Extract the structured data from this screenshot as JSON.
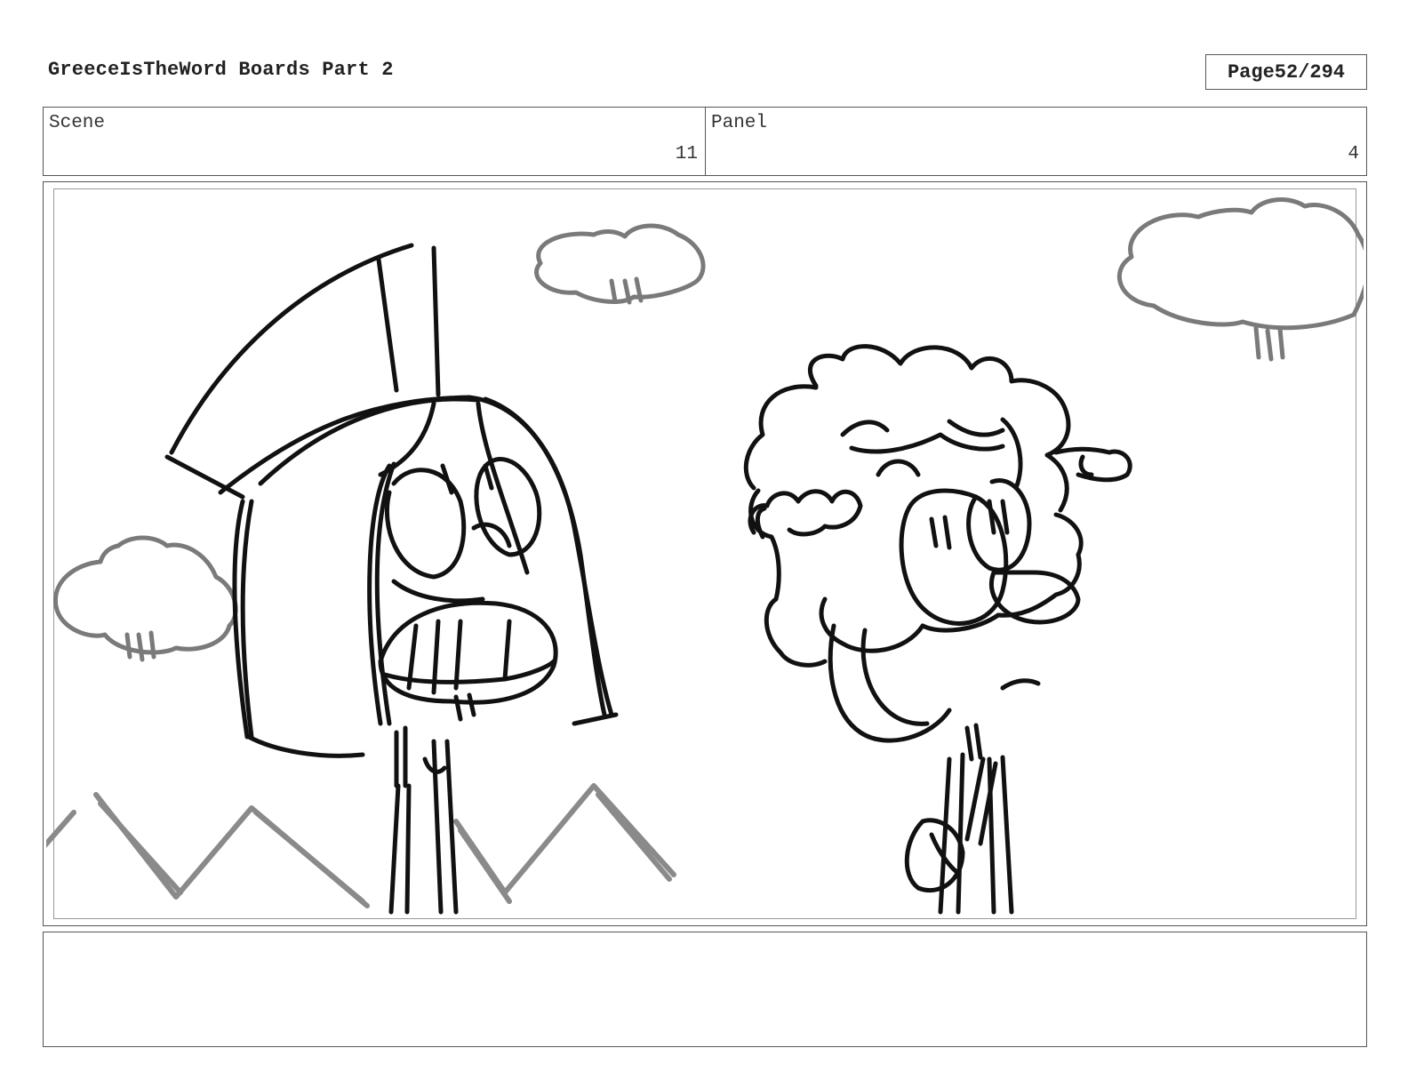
{
  "header": {
    "title": "GreeceIsTheWord Boards Part 2",
    "page_label": "Page",
    "page_number": "52/294"
  },
  "info": {
    "scene_label": "Scene",
    "scene_value": "11",
    "panel_label": "Panel",
    "panel_value": "4"
  },
  "notes": {
    "text": ""
  }
}
